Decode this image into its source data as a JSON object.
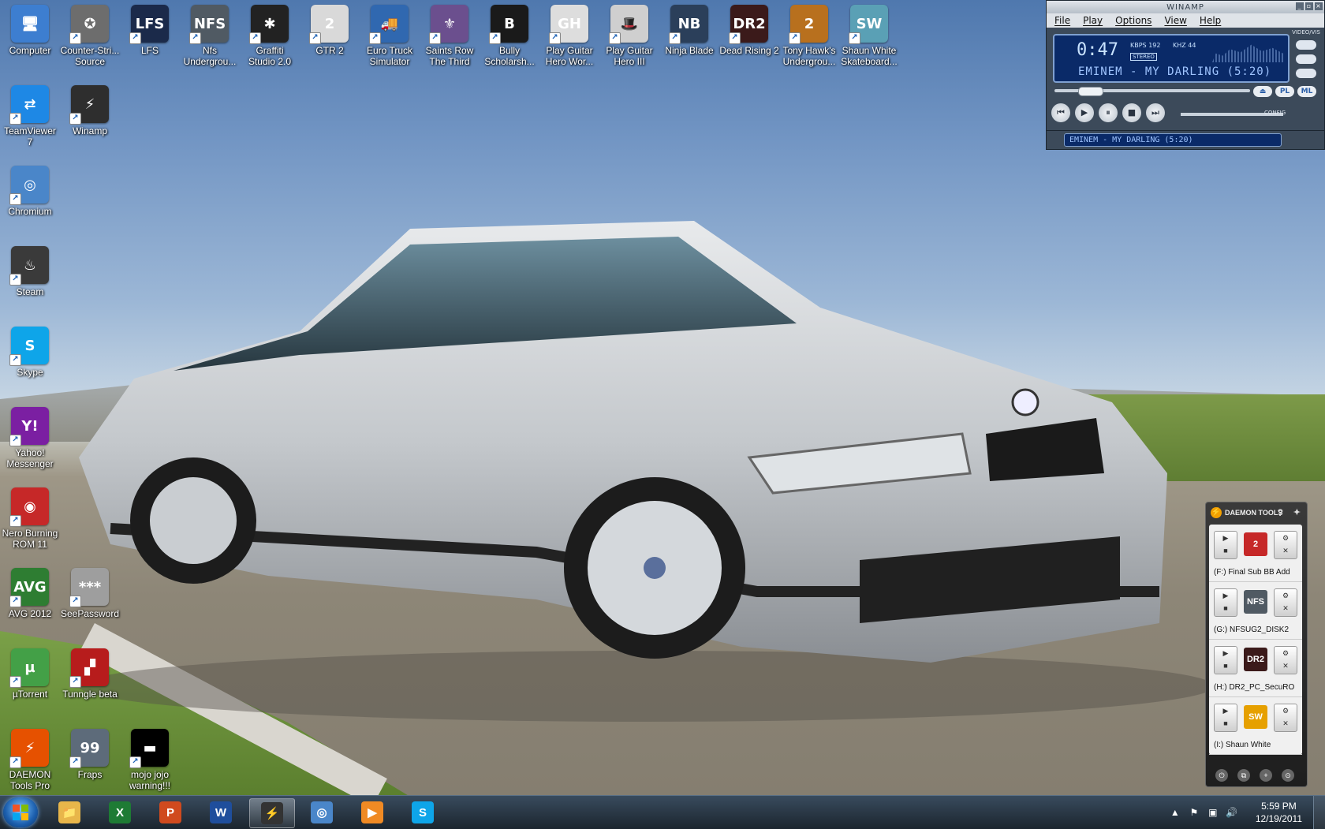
{
  "desktop": {
    "icons": [
      {
        "label": "Computer",
        "glyph": "🖥",
        "color": "#3d7ed0"
      },
      {
        "label": "Counter-Stri...\nSource",
        "glyph": "✪",
        "color": "#6d6d6d"
      },
      {
        "label": "LFS",
        "glyph": "LFS",
        "color": "#1b2a4a"
      },
      {
        "label": "Nfs\nUndergrou...",
        "glyph": "NFS",
        "color": "#505a63"
      },
      {
        "label": "Graffiti\nStudio 2.0",
        "glyph": "✱",
        "color": "#222222"
      },
      {
        "label": "GTR 2",
        "glyph": "2",
        "color": "#d9d9d9"
      },
      {
        "label": "Euro Truck\nSimulator",
        "glyph": "🚚",
        "color": "#3068b0"
      },
      {
        "label": "Saints Row\nThe Third",
        "glyph": "⚜",
        "color": "#6b4f8e"
      },
      {
        "label": "Bully\nScholarsh...",
        "glyph": "B",
        "color": "#1a1a1a"
      },
      {
        "label": "Play Guitar\nHero Wor...",
        "glyph": "GH",
        "color": "#dddddd"
      },
      {
        "label": "Play Guitar\nHero III",
        "glyph": "🎩",
        "color": "#cfcfcf"
      },
      {
        "label": "Ninja Blade",
        "glyph": "NB",
        "color": "#2b3f5a"
      },
      {
        "label": "Dead Rising 2",
        "glyph": "DR2",
        "color": "#3b1a1a"
      },
      {
        "label": "Tony Hawk's\nUndergrou...",
        "glyph": "2",
        "color": "#b8701e"
      },
      {
        "label": "Shaun White\nSkateboard...",
        "glyph": "SW",
        "color": "#5aa0b5"
      },
      {
        "label": "TeamViewer\n7",
        "glyph": "⇄",
        "color": "#1e88e5"
      },
      {
        "label": "Winamp",
        "glyph": "⚡",
        "color": "#2e2e2e"
      },
      {
        "label": "Chromium",
        "glyph": "◎",
        "color": "#4a86c9"
      },
      {
        "label": "Steam",
        "glyph": "♨",
        "color": "#3a3a3a"
      },
      {
        "label": "Skype",
        "glyph": "S",
        "color": "#0ea5e9"
      },
      {
        "label": "Yahoo!\nMessenger",
        "glyph": "Y!",
        "color": "#7b1fa2"
      },
      {
        "label": "Nero Burning\nROM 11",
        "glyph": "◉",
        "color": "#c62828"
      },
      {
        "label": "AVG 2012",
        "glyph": "AVG",
        "color": "#2e7d32"
      },
      {
        "label": "SeePassword",
        "glyph": "***",
        "color": "#9e9e9e"
      },
      {
        "label": "µTorrent",
        "glyph": "µ",
        "color": "#43a047"
      },
      {
        "label": "Tunngle beta",
        "glyph": "▞",
        "color": "#b71c1c"
      },
      {
        "label": "DAEMON\nTools Pro",
        "glyph": "⚡",
        "color": "#e65100"
      },
      {
        "label": "Fraps",
        "glyph": "99",
        "color": "#5d6b7a"
      },
      {
        "label": "mojo jojo\nwarning!!!",
        "glyph": "▬",
        "color": "#000000"
      }
    ]
  },
  "winamp": {
    "title": "WINAMP",
    "menu": [
      "File",
      "Play",
      "Options",
      "View",
      "Help"
    ],
    "time": "0:47",
    "kbps_label": "KBPS",
    "kbps": "192",
    "khz_label": "KHZ",
    "khz": "44",
    "stereo": "STEREO",
    "song": "EMINEM - MY DARLING (5:20)",
    "side_label": "VIDEO/VIS",
    "config_label": "CONFIG",
    "eq": [
      "⏏",
      "PL",
      "ML"
    ],
    "transport": [
      "⏮",
      "▶",
      "⏸",
      "■",
      "⏭"
    ],
    "playlist_song": "EMINEM - MY DARLING (5:20)"
  },
  "daemon": {
    "title": "DAEMON TOOLS",
    "drives": [
      {
        "name": "(F:) Final Sub BB Add",
        "glyph": "2",
        "color": "#c62828"
      },
      {
        "name": "(G:) NFSUG2_DISK2",
        "glyph": "NFS",
        "color": "#505a63"
      },
      {
        "name": "(H:) DR2_PC_SecuRO",
        "glyph": "DR2",
        "color": "#3b1a1a"
      },
      {
        "name": "(I:) Shaun White",
        "glyph": "SW",
        "color": "#e6a000"
      }
    ]
  },
  "taskbar": {
    "apps": [
      {
        "name": "explorer",
        "glyph": "📁",
        "color": "#e8b64a",
        "active": false
      },
      {
        "name": "excel",
        "glyph": "X",
        "color": "#1e7b34",
        "active": false
      },
      {
        "name": "powerpoint",
        "glyph": "P",
        "color": "#d04a1e",
        "active": false
      },
      {
        "name": "word",
        "glyph": "W",
        "color": "#1f4e9c",
        "active": false
      },
      {
        "name": "winamp",
        "glyph": "⚡",
        "color": "#333333",
        "active": true
      },
      {
        "name": "chromium",
        "glyph": "◎",
        "color": "#4a86c9",
        "active": false
      },
      {
        "name": "media-player",
        "glyph": "▶",
        "color": "#f08a24",
        "active": false
      },
      {
        "name": "skype",
        "glyph": "S",
        "color": "#0ea5e9",
        "active": false
      }
    ],
    "time": "5:59 PM",
    "date": "12/19/2011"
  }
}
